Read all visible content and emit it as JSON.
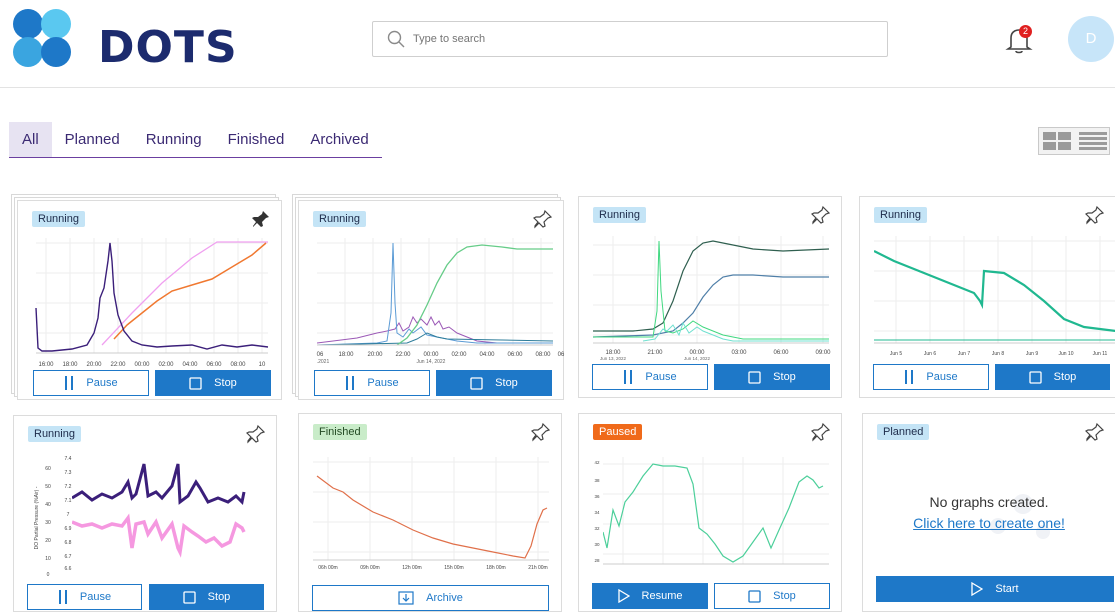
{
  "app": {
    "brand": "DOTS"
  },
  "search": {
    "placeholder": "Type to search"
  },
  "notifications": {
    "count": "2"
  },
  "user": {
    "initial": "D"
  },
  "tabs": [
    "All",
    "Planned",
    "Running",
    "Finished",
    "Archived"
  ],
  "colors": {
    "primary": "#1e78c8",
    "brand": "#1c2b6e",
    "tab_accent": "#6b3fa0",
    "paused": "#f06a1a",
    "running_badge": "#c4e4f6",
    "finished_badge": "#c9ecc9"
  },
  "cards": [
    {
      "status": "Running",
      "pinned": true,
      "buttons": [
        "Pause",
        "Stop"
      ],
      "x_ticks": [
        "16:00",
        "18:00",
        "20:00",
        "22:00",
        "00:00",
        "02:00",
        "04:00",
        "06:00",
        "08:00",
        "10"
      ]
    },
    {
      "status": "Running",
      "pinned": false,
      "buttons": [
        "Pause",
        "Stop"
      ],
      "x_ticks": [
        "06",
        "18:00",
        "20:00",
        "22:00",
        "00:00",
        "02:00",
        "04:00",
        "06:00",
        "08:00",
        "06"
      ],
      "x_subticks": [
        ".2021",
        "Jun 14, 2022"
      ]
    },
    {
      "status": "Running",
      "pinned": false,
      "buttons": [
        "Pause",
        "Stop"
      ],
      "x_ticks": [
        "18:00",
        "21:00",
        "00:00",
        "03:00",
        "06:00",
        "09:00"
      ],
      "x_subticks": [
        "Jun 13, 2022",
        "Jun 14, 2022"
      ]
    },
    {
      "status": "Running",
      "pinned": false,
      "buttons": [
        "Pause",
        "Stop"
      ],
      "x_ticks": [
        "Jun 5",
        "Jun 6",
        "Jun 7",
        "Jun 8",
        "Jun 9",
        "Jun 10",
        "Jun 11"
      ]
    },
    {
      "status": "Running",
      "pinned": false,
      "buttons": [
        "Pause",
        "Stop"
      ],
      "y_label": "DO Partial Pressure (%Air) -",
      "y_ticks_left": [
        "60",
        "50",
        "40",
        "30",
        "20",
        "10",
        "0"
      ],
      "y_ticks_right": [
        "7.4",
        "7.3",
        "7.2",
        "7.1",
        "7",
        "6.9",
        "6.8",
        "6.7",
        "6.6"
      ]
    },
    {
      "status": "Finished",
      "pinned": false,
      "buttons": [
        "Archive"
      ],
      "x_ticks": [
        "06h 00m",
        "09h 00m",
        "12h 00m",
        "15h 00m",
        "18h 00m",
        "21h 00m"
      ]
    },
    {
      "status": "Paused",
      "pinned": false,
      "buttons": [
        "Resume",
        "Stop"
      ],
      "y_ticks": [
        "42",
        "38",
        "36",
        "34",
        "32",
        "30",
        "28"
      ]
    },
    {
      "status": "Planned",
      "pinned": false,
      "buttons": [
        "Start"
      ],
      "empty_message": "No graphs created.",
      "empty_link": "Click here to create one!"
    }
  ]
}
